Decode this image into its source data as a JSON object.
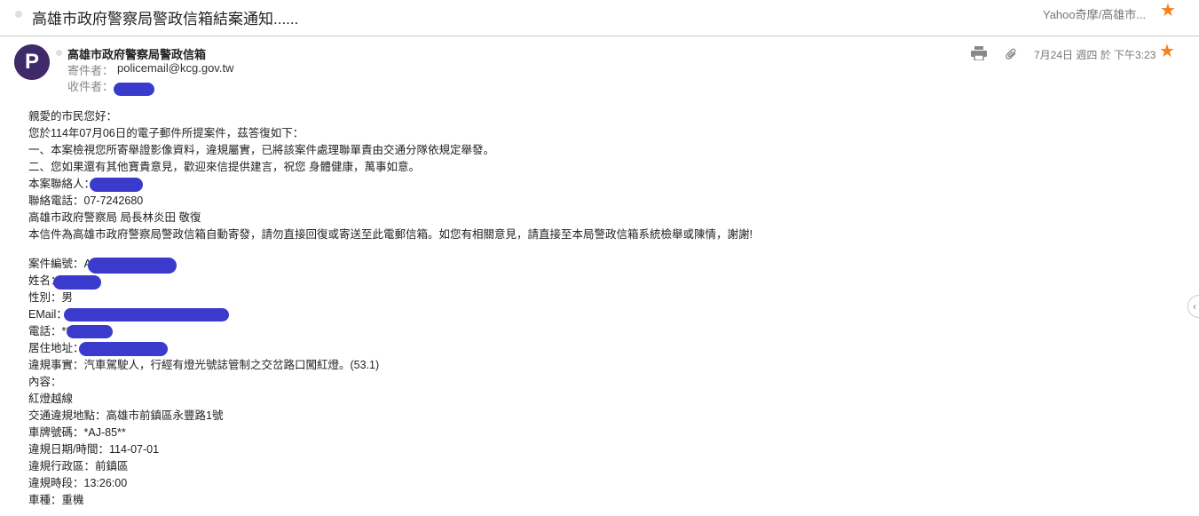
{
  "subject": {
    "title": "高雄市政府警察局警政信箱結案通知......",
    "source": "Yahoo奇摩/高雄市...",
    "star_icon": "star-icon"
  },
  "header": {
    "sender_name": "高雄市政府警察局警政信箱",
    "from_label": "寄件者：",
    "from_email": "policemail@kcg.gov.tw",
    "to_label": "收件者：",
    "date": "7月24日 週四 於 下午3:23",
    "avatar_letter": "P"
  },
  "body": {
    "greeting": "親愛的市民您好：",
    "line1": "您於114年07月06日的電子郵件所提案件，茲答復如下：",
    "line2": "一、本案檢視您所寄舉證影像資料，違規屬實，已將該案件處理聯單責由交通分隊依規定舉發。",
    "line3": "二、您如果還有其他寶貴意見，歡迎來信提供建言，祝您 身體健康，萬事如意。",
    "contact_person": "本案聯絡人：",
    "contact_phone": "聯絡電話：07-7242680",
    "signature": "高雄市政府警察局 局長林炎田 敬復",
    "notice": "本信件為高雄市政府警察局警政信箱自動寄發，請勿直接回復或寄送至此電郵信箱。如您有相關意見，請直接至本局警政信箱系統檢舉或陳情，謝謝!",
    "case_no": "案件編號：A",
    "name": "姓名：",
    "gender": "性別：男",
    "email": "EMail：",
    "phone": "電話：**",
    "address": "居住地址：",
    "violation": "違規事實：汽車駕駛人，行經有燈光號誌管制之交岔路口闖紅燈。(53.1)",
    "content_label": "內容：",
    "content": "紅燈越線",
    "location": "交通違規地點：高雄市前鎮區永豐路1號",
    "plate": "車牌號碼：*AJ-85**",
    "date": "違規日期/時間：114-07-01",
    "district": "違規行政區：前鎮區",
    "time": "違規時段：13:26:00",
    "vehicle": "車種：重機"
  },
  "colors": {
    "accent_star": "#f77f1a",
    "redaction": "#3a3acd",
    "avatar_bg": "#3d2a69",
    "avatar_ring": "#e5196b"
  }
}
